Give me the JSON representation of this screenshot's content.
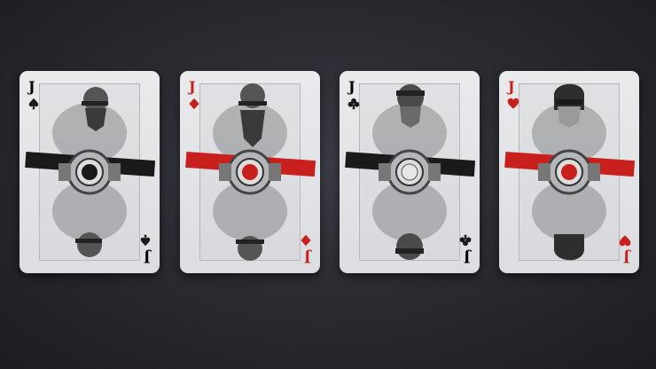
{
  "cards": [
    {
      "rank": "J",
      "suit": "spade-icon",
      "accent": "#1a1a1a",
      "ink": "#222222"
    },
    {
      "rank": "J",
      "suit": "diamond-icon",
      "accent": "#c8201d",
      "ink": "#c8201d"
    },
    {
      "rank": "J",
      "suit": "club-icon",
      "accent": "#1a1a1a",
      "ink": "#222222"
    },
    {
      "rank": "J",
      "suit": "heart-icon",
      "accent": "#c8201d",
      "ink": "#c8201d"
    }
  ]
}
